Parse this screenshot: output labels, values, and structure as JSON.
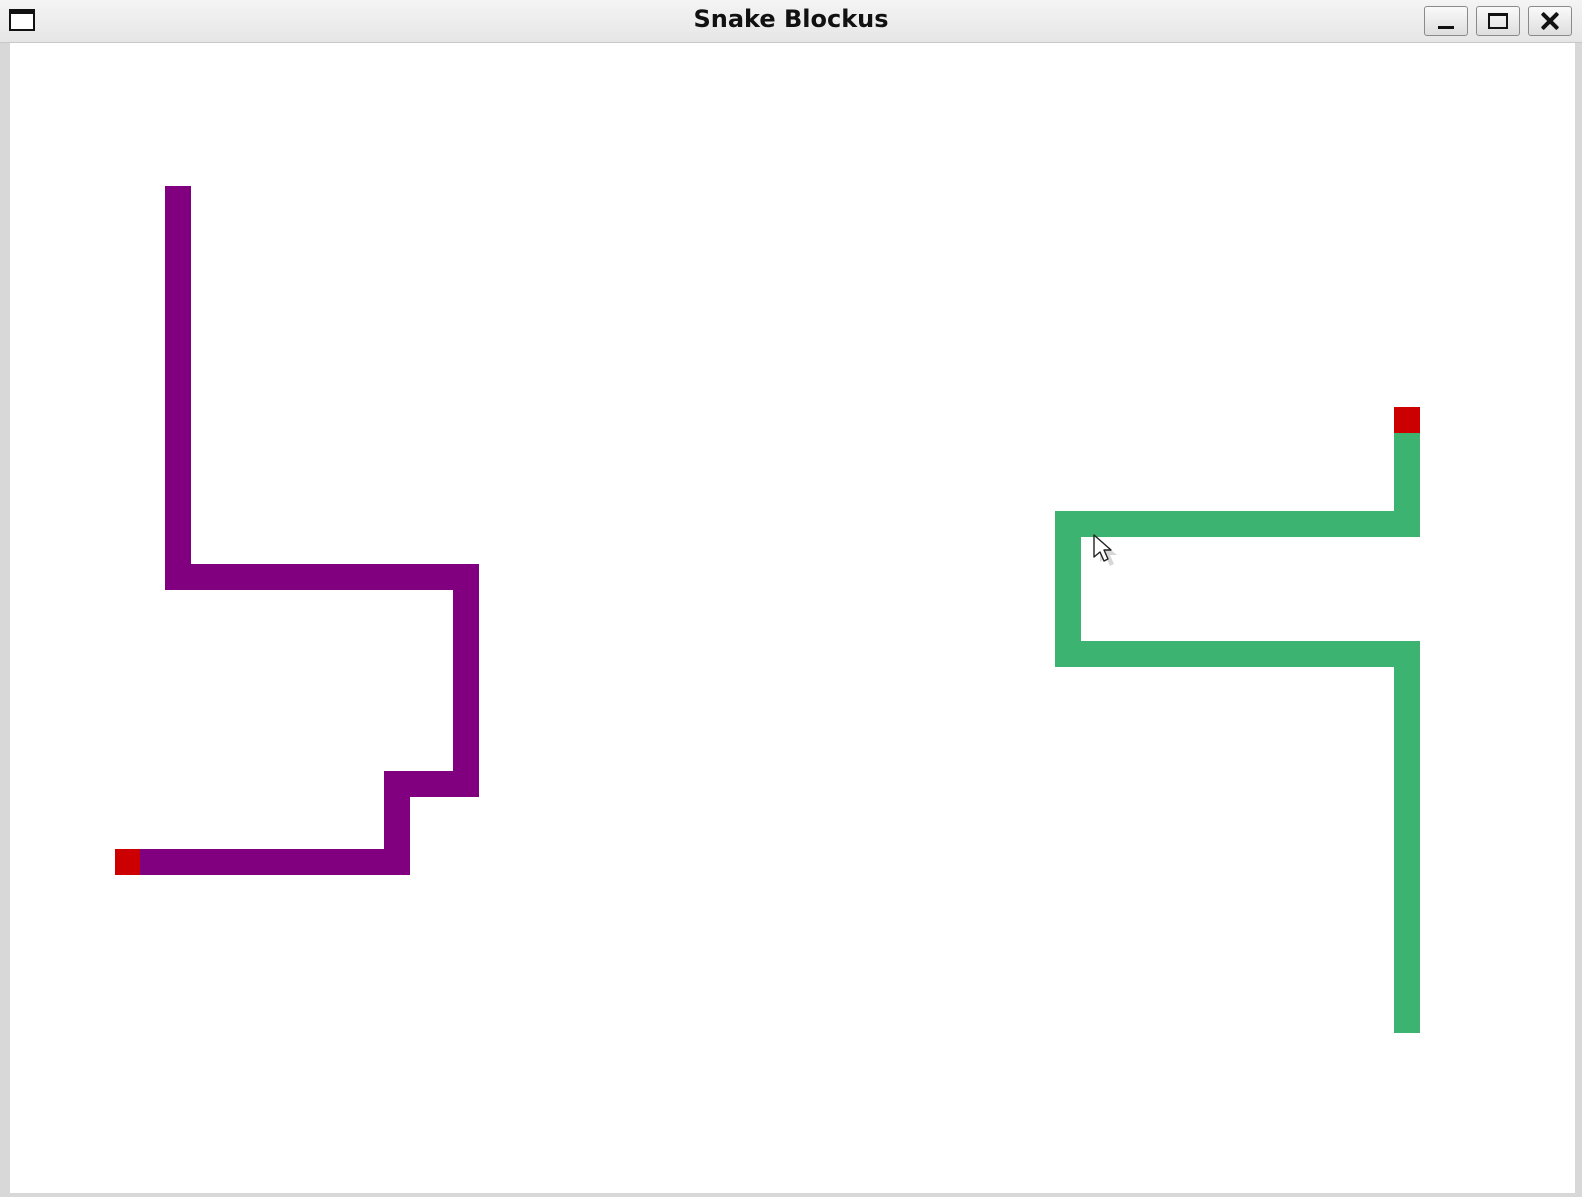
{
  "window": {
    "title": "Snake Blockus",
    "app_icon": "window-icon",
    "controls": [
      "minimize-icon",
      "maximize-icon",
      "close-icon"
    ]
  },
  "game": {
    "head_color": "#cc0000",
    "snakes": [
      {
        "id": "purple",
        "color": "#800080"
      },
      {
        "id": "green",
        "color": "#3cb371"
      }
    ]
  },
  "cursor": {
    "icon": "mouse-pointer-icon"
  }
}
